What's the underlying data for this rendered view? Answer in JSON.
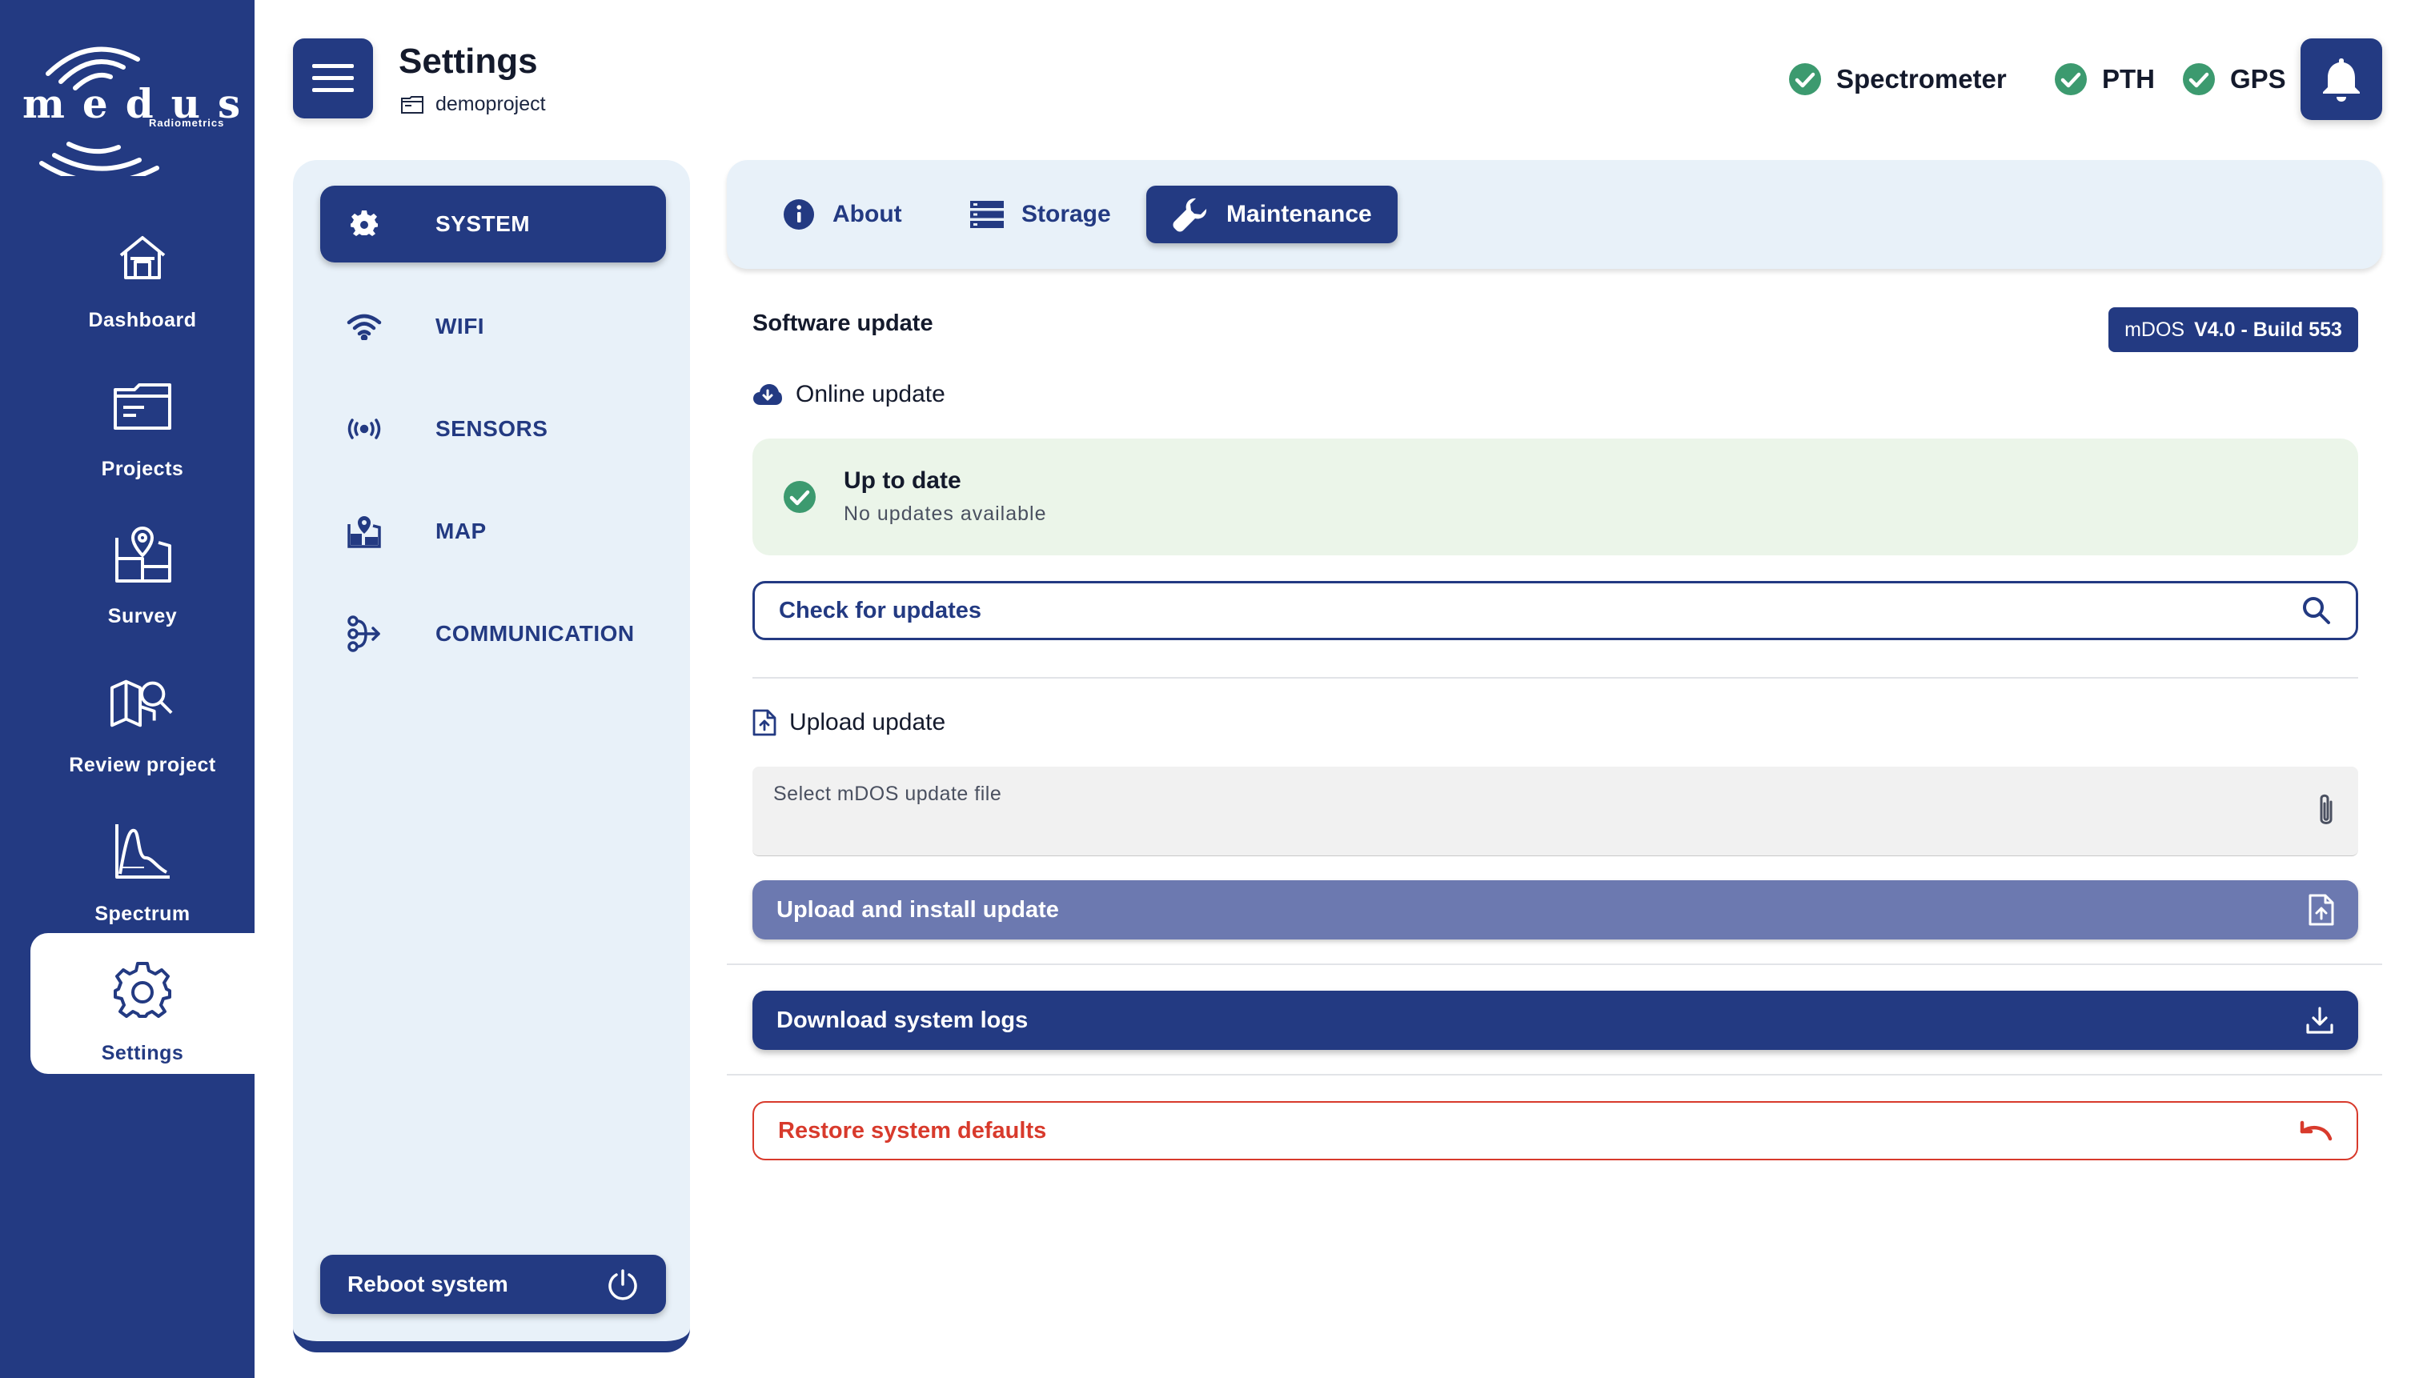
{
  "brand": {
    "name": "medusa",
    "sub": "Radiometrics"
  },
  "nav": {
    "items": [
      {
        "label": "Dashboard",
        "icon": "home-icon"
      },
      {
        "label": "Projects",
        "icon": "folder-icon"
      },
      {
        "label": "Survey",
        "icon": "survey-map-icon"
      },
      {
        "label": "Review project",
        "icon": "map-search-icon"
      },
      {
        "label": "Spectrum",
        "icon": "spectrum-chart-icon"
      },
      {
        "label": "Settings",
        "icon": "gear-icon",
        "active": true
      }
    ]
  },
  "header": {
    "title": "Settings",
    "project": "demoproject",
    "statuses": [
      {
        "label": "Spectrometer",
        "ok": true
      },
      {
        "label": "PTH",
        "ok": true
      },
      {
        "label": "GPS",
        "ok": true
      }
    ]
  },
  "settings_menu": {
    "items": [
      {
        "label": "SYSTEM",
        "icon": "gear-icon",
        "active": true
      },
      {
        "label": "WIFI",
        "icon": "wifi-icon"
      },
      {
        "label": "SENSORS",
        "icon": "sensor-icon"
      },
      {
        "label": "MAP",
        "icon": "map-icon"
      },
      {
        "label": "COMMUNICATION",
        "icon": "communication-icon"
      }
    ],
    "reboot_label": "Reboot system"
  },
  "tabs": [
    {
      "label": "About",
      "icon": "info-icon"
    },
    {
      "label": "Storage",
      "icon": "storage-icon"
    },
    {
      "label": "Maintenance",
      "icon": "wrench-icon",
      "active": true
    }
  ],
  "maintenance": {
    "section_title": "Software update",
    "version_prefix": "mDOS",
    "version": "V4.0 - Build 553",
    "online_update_label": "Online update",
    "status_title": "Up to date",
    "status_subtitle": "No updates available",
    "check_button": "Check for updates",
    "upload_update_label": "Upload update",
    "file_placeholder": "Select mDOS update file",
    "upload_button": "Upload and install update",
    "download_logs_button": "Download system logs",
    "restore_button": "Restore system defaults"
  },
  "colors": {
    "brand": "#233a82",
    "panel": "#e8f1f9",
    "success": "#3c9a6f",
    "success_bg": "#ebf5e9",
    "danger": "#d83a2c",
    "disabled": "#6c79b0"
  }
}
